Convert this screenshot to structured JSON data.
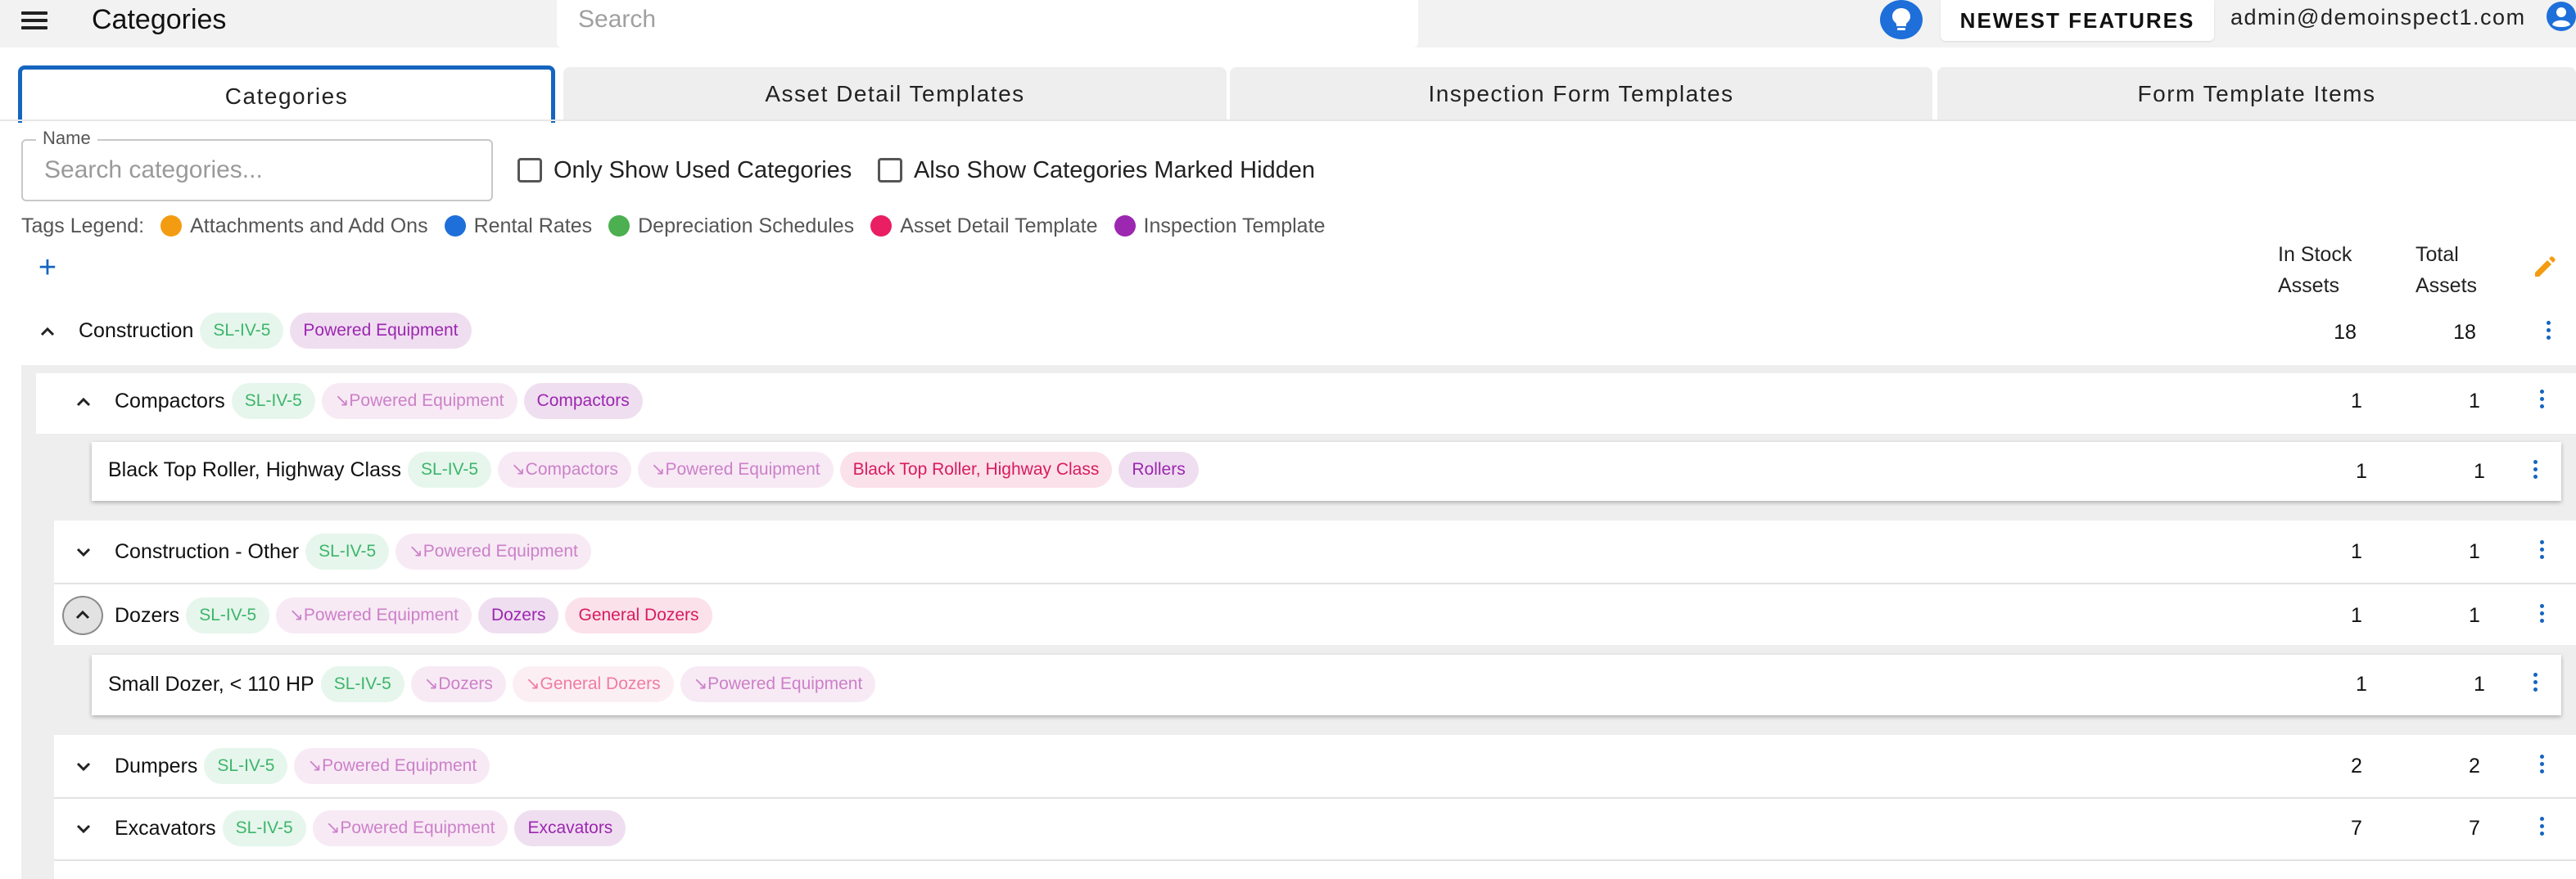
{
  "header": {
    "title": "Categories",
    "search_placeholder": "Search",
    "newest_features_label": "NEWEST FEATURES",
    "user_email": "admin@demoinspect1.com"
  },
  "tabs": [
    {
      "label": "Categories",
      "active": true
    },
    {
      "label": "Asset Detail Templates",
      "active": false
    },
    {
      "label": "Inspection Form Templates",
      "active": false
    },
    {
      "label": "Form Template Items",
      "active": false
    }
  ],
  "filters": {
    "name_label": "Name",
    "name_placeholder": "Search categories...",
    "only_used_label": "Only Show Used Categories",
    "only_used_checked": false,
    "show_hidden_label": "Also Show Categories Marked Hidden",
    "show_hidden_checked": false
  },
  "legend": {
    "title": "Tags Legend:",
    "items": [
      {
        "label": "Attachments and Add Ons",
        "color": "#f39c12"
      },
      {
        "label": "Rental Rates",
        "color": "#1e6fd9"
      },
      {
        "label": "Depreciation Schedules",
        "color": "#4caf50"
      },
      {
        "label": "Asset Detail Template",
        "color": "#e91e63"
      },
      {
        "label": "Inspection Template",
        "color": "#9c27b0"
      }
    ]
  },
  "columns": {
    "in_stock_line1": "In Stock",
    "in_stock_line2": "Assets",
    "total_line1": "Total",
    "total_line2": "Assets"
  },
  "tree": {
    "root": {
      "name": "Construction",
      "expanded": true,
      "tags": [
        "SL-IV-5",
        "Powered Equipment"
      ],
      "in_stock": "18",
      "total": "18"
    },
    "compactors": {
      "name": "Compactors",
      "expanded": true,
      "tags": [
        "SL-IV-5",
        "↘Powered Equipment",
        "Compactors"
      ],
      "in_stock": "1",
      "total": "1"
    },
    "black_top_roller": {
      "name": "Black Top Roller, Highway Class",
      "tags": [
        "SL-IV-5",
        "↘Compactors",
        "↘Powered Equipment",
        "Black Top Roller, Highway Class",
        "Rollers"
      ],
      "in_stock": "1",
      "total": "1"
    },
    "construction_other": {
      "name": "Construction - Other",
      "expanded": false,
      "tags": [
        "SL-IV-5",
        "↘Powered Equipment"
      ],
      "in_stock": "1",
      "total": "1"
    },
    "dozers": {
      "name": "Dozers",
      "expanded": true,
      "tags": [
        "SL-IV-5",
        "↘Powered Equipment",
        "Dozers",
        "General Dozers"
      ],
      "in_stock": "1",
      "total": "1"
    },
    "small_dozer": {
      "name": "Small Dozer, < 110 HP",
      "tags": [
        "SL-IV-5",
        "↘Dozers",
        "↘General Dozers",
        "↘Powered Equipment"
      ],
      "in_stock": "1",
      "total": "1"
    },
    "dumpers": {
      "name": "Dumpers",
      "expanded": false,
      "tags": [
        "SL-IV-5",
        "↘Powered Equipment"
      ],
      "in_stock": "2",
      "total": "2"
    },
    "excavators": {
      "name": "Excavators",
      "expanded": false,
      "tags": [
        "SL-IV-5",
        "↘Powered Equipment",
        "Excavators"
      ],
      "in_stock": "7",
      "total": "7"
    }
  }
}
